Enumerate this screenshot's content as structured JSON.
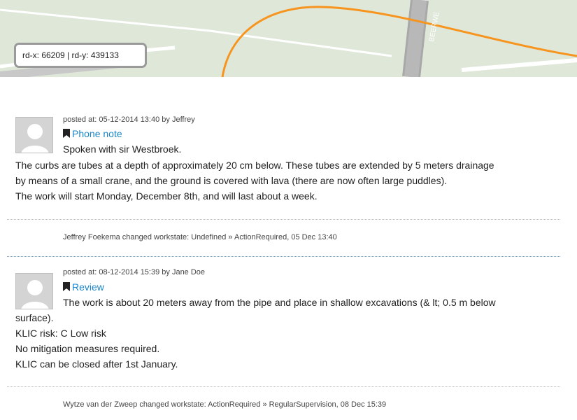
{
  "map": {
    "coord_text": "rd-x: 66209 | rd-y: 439133",
    "road_label": "BEERWE",
    "colors": {
      "land": "#dfe7d9",
      "road": "#a8a8a8",
      "route": "#f7941d"
    }
  },
  "posts": [
    {
      "meta": "posted at: 05-12-2014 13:40 by Jeffrey",
      "type": "Phone note",
      "lines": [
        "Spoken with sir Westbroek.",
        "The curbs are tubes at a depth of approximately 20 cm below. These tubes are extended by 5 meters drainage",
        "by means of a small crane, and the ground is covered with lava (there are now often large puddles).",
        "The work will start Monday, December 8th, and will last about a week."
      ],
      "change": "Jeffrey Foekema changed workstate: Undefined » ActionRequired, 05 Dec 13:40"
    },
    {
      "meta": "posted at: 08-12-2014 15:39 by Jane Doe",
      "type": "Review",
      "lines": [
        "The work is about 20 meters away from the pipe and place in shallow excavations (& lt; 0.5 m below",
        "surface).",
        "KLIC risk: C Low risk",
        "No mitigation measures required.",
        "KLIC can be closed after 1st January."
      ],
      "change": "Wytze van der Zweep changed workstate: ActionRequired » RegularSupervision, 08 Dec 15:39"
    }
  ],
  "icons": {
    "bookmark": "bookmark-icon",
    "avatar": "avatar-placeholder-icon"
  },
  "accent": "#1a86c8"
}
